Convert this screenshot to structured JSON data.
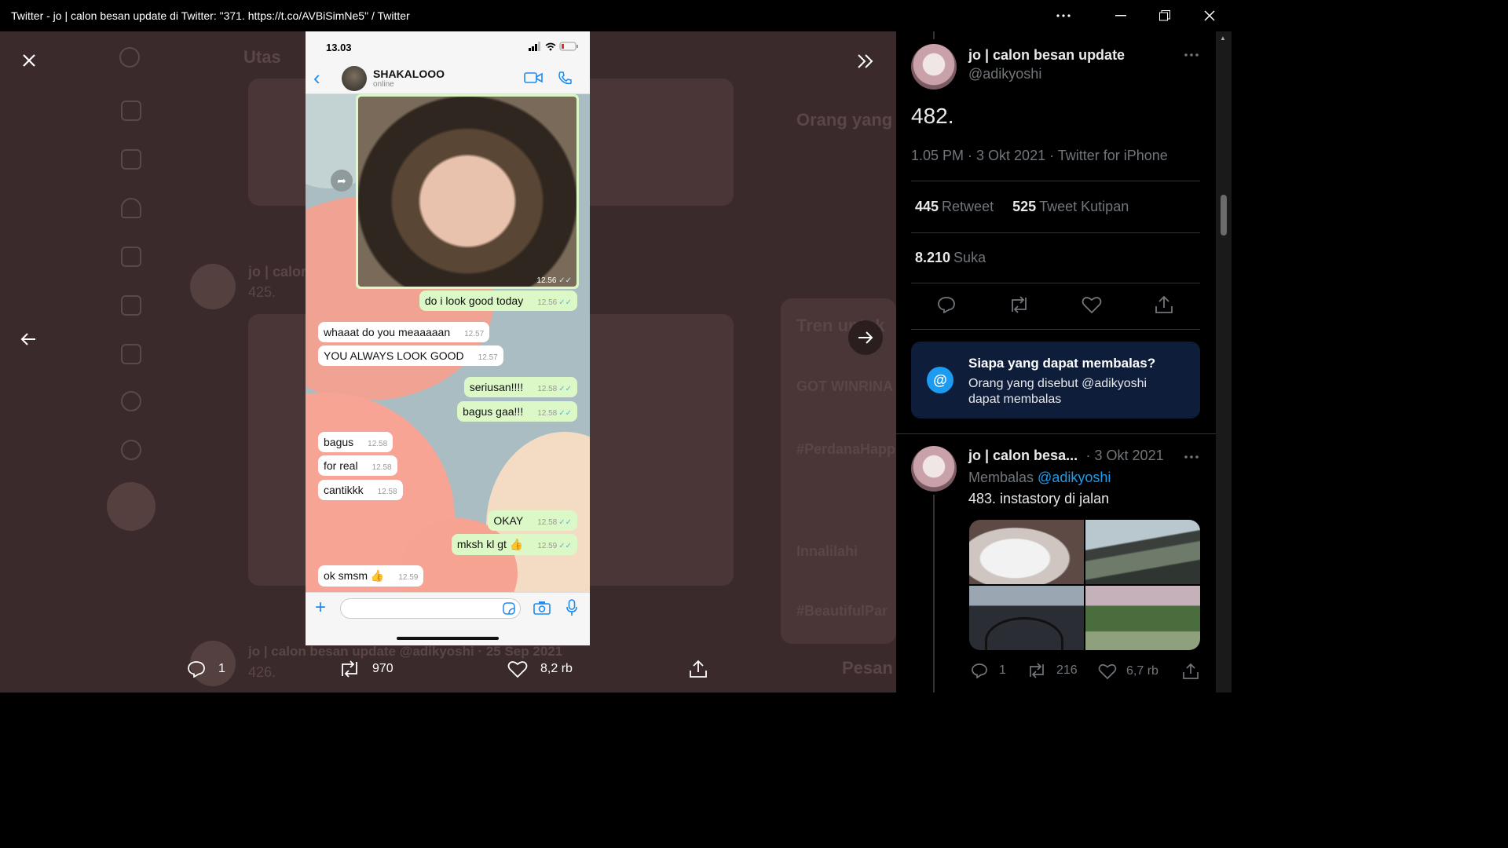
{
  "window": {
    "title": "Twitter - jo | calon besan update di Twitter: \"371. https://t.co/AVBiSimNe5\" / Twitter"
  },
  "background_timeline": {
    "header": "Utas",
    "tweets": [
      {
        "author": "jo | calon",
        "text": "425."
      },
      {
        "author": "jo | calon besan update @adikyoshi · 25 Sep 2021",
        "text": "426."
      }
    ],
    "sidebar_headings": [
      "Orang yang",
      "Tren untuk"
    ],
    "trends": [
      "GOT WINRINA",
      "#PerdanaHapp",
      "Innalilahi",
      "#BeautifulPar"
    ],
    "messages_label": "Pesan"
  },
  "phone": {
    "time": "13.03",
    "contact_name": "SHAKALOOO",
    "contact_status": "online",
    "photo_time": "12.56",
    "messages": [
      {
        "dir": "out",
        "text": "do i look good today",
        "time": "12.56"
      },
      {
        "dir": "in",
        "text": "whaaat do you meaaaaan",
        "time": "12.57"
      },
      {
        "dir": "in",
        "text": "YOU ALWAYS LOOK GOOD",
        "time": "12.57"
      },
      {
        "dir": "out",
        "text": "seriusan!!!!",
        "time": "12.58"
      },
      {
        "dir": "out",
        "text": "bagus gaa!!!",
        "time": "12.58"
      },
      {
        "dir": "in",
        "text": "bagus",
        "time": "12.58"
      },
      {
        "dir": "in",
        "text": "for real",
        "time": "12.58"
      },
      {
        "dir": "in",
        "text": "cantikkk",
        "time": "12.58"
      },
      {
        "dir": "out",
        "text": "OKAY",
        "time": "12.58"
      },
      {
        "dir": "out",
        "text": "mksh kl gt 👍",
        "time": "12.59"
      },
      {
        "dir": "in",
        "text": "ok smsm 👍",
        "time": "12.59"
      }
    ]
  },
  "media_bar": {
    "replies": "1",
    "retweets": "970",
    "likes": "8,2 rb"
  },
  "tweet": {
    "display_name": "jo | calon besan update",
    "handle": "@adikyoshi",
    "text": "482.",
    "meta": "1.05 PM · 3 Okt 2021 · Twitter for iPhone",
    "retweets_count": "445",
    "retweets_label": "Retweet",
    "quotes_count": "525",
    "quotes_label": "Tweet Kutipan",
    "likes_count": "8.210",
    "likes_label": "Suka"
  },
  "reply_restriction": {
    "title": "Siapa yang dapat membalas?",
    "body": "Orang yang disebut @adikyoshi dapat membalas"
  },
  "reply": {
    "display_name": "jo | calon besa...",
    "date": "· 3 Okt 2021",
    "replying_label": "Membalas",
    "replying_handle": "@adikyoshi",
    "text": "483. instastory di jalan",
    "replies": "1",
    "retweets": "216",
    "likes": "6,7 rb"
  },
  "colors": {
    "accent": "#1d9bf0",
    "bubble_out": "#dcf8c6",
    "overlay": "#3b2a2b"
  }
}
